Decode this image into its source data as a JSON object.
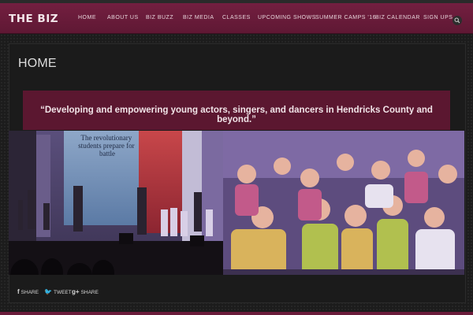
{
  "header": {
    "logo": "THE BIZ",
    "nav": [
      "HOME",
      "ABOUT US",
      "BIZ BUZZ",
      "BIZ MEDIA",
      "CLASSES",
      "UPCOMING SHOWS",
      "SUMMER CAMPS '16",
      "BIZ CALENDAR",
      "SIGN UPS"
    ],
    "search_icon": "search-icon"
  },
  "main": {
    "page_title": "HOME",
    "tagline": "“Developing and empowering young actors, singers, and dancers in Hendricks County and beyond.”",
    "stage_banner_text": "The revolutionary students prepare for battle"
  },
  "share": {
    "facebook": "SHARE",
    "twitter": "TWEET",
    "google": "SHARE"
  },
  "colors": {
    "brand": "#6a1c3a",
    "banner": "#5b1730",
    "background": "#1f1f1f"
  }
}
